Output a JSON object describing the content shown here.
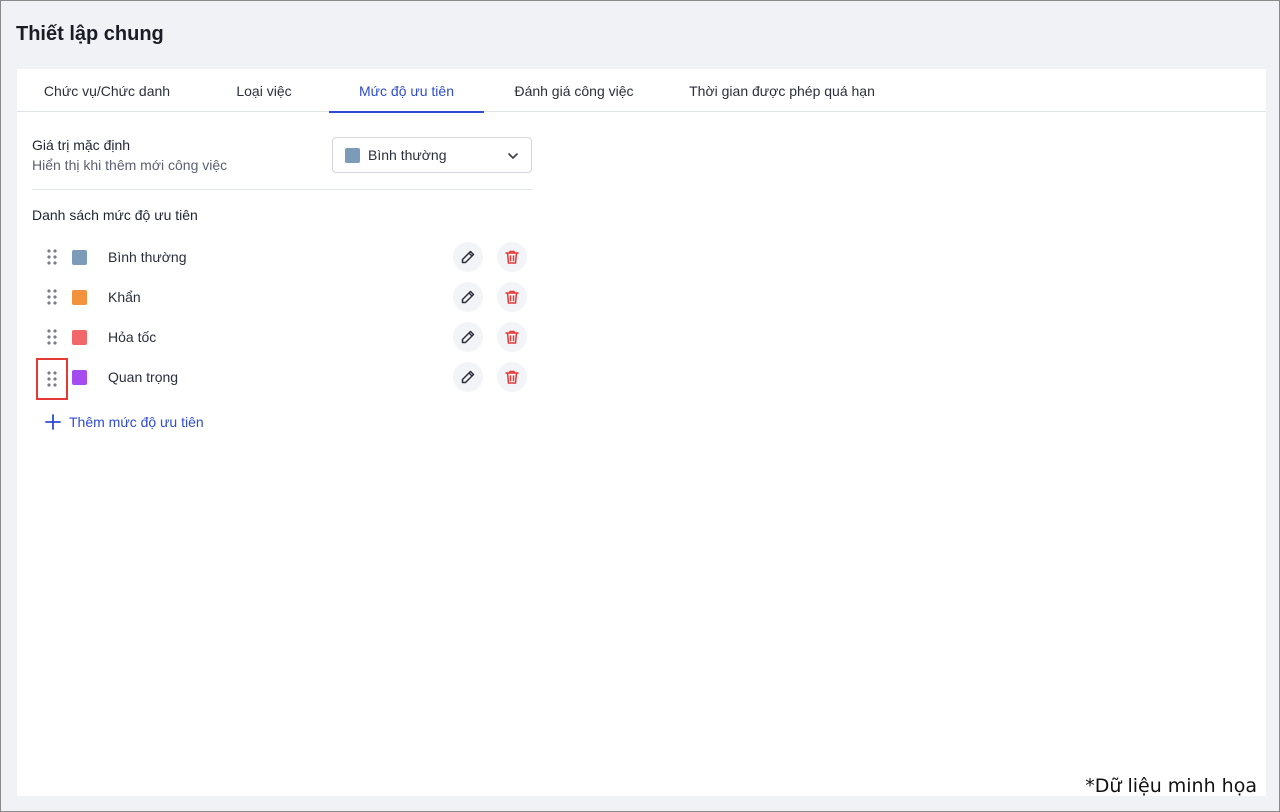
{
  "page": {
    "title": "Thiết lập chung"
  },
  "tabs": [
    {
      "label": "Chức vụ/Chức danh"
    },
    {
      "label": "Loại việc"
    },
    {
      "label": "Mức độ ưu tiên"
    },
    {
      "label": "Đánh giá công việc"
    },
    {
      "label": "Thời gian được phép quá hạn"
    }
  ],
  "default_value": {
    "title": "Giá trị mặc định",
    "subtitle": "Hiển thị khi thêm mới công việc",
    "selected": "Bình thường",
    "selected_color": "#7b9bb8"
  },
  "priority_list": {
    "title": "Danh sách mức độ ưu tiên",
    "items": [
      {
        "label": "Bình thường",
        "color": "#7b9bb8"
      },
      {
        "label": "Khẩn",
        "color": "#f4913d"
      },
      {
        "label": "Hỏa tốc",
        "color": "#f2686a"
      },
      {
        "label": "Quan trọng",
        "color": "#a44cf0"
      }
    ],
    "add_label": "Thêm mức độ ưu tiên"
  },
  "colors": {
    "accent": "#2e4bd2",
    "delete": "#e53935",
    "highlight": "#e53935"
  },
  "watermark": "*Dữ liệu minh họa"
}
